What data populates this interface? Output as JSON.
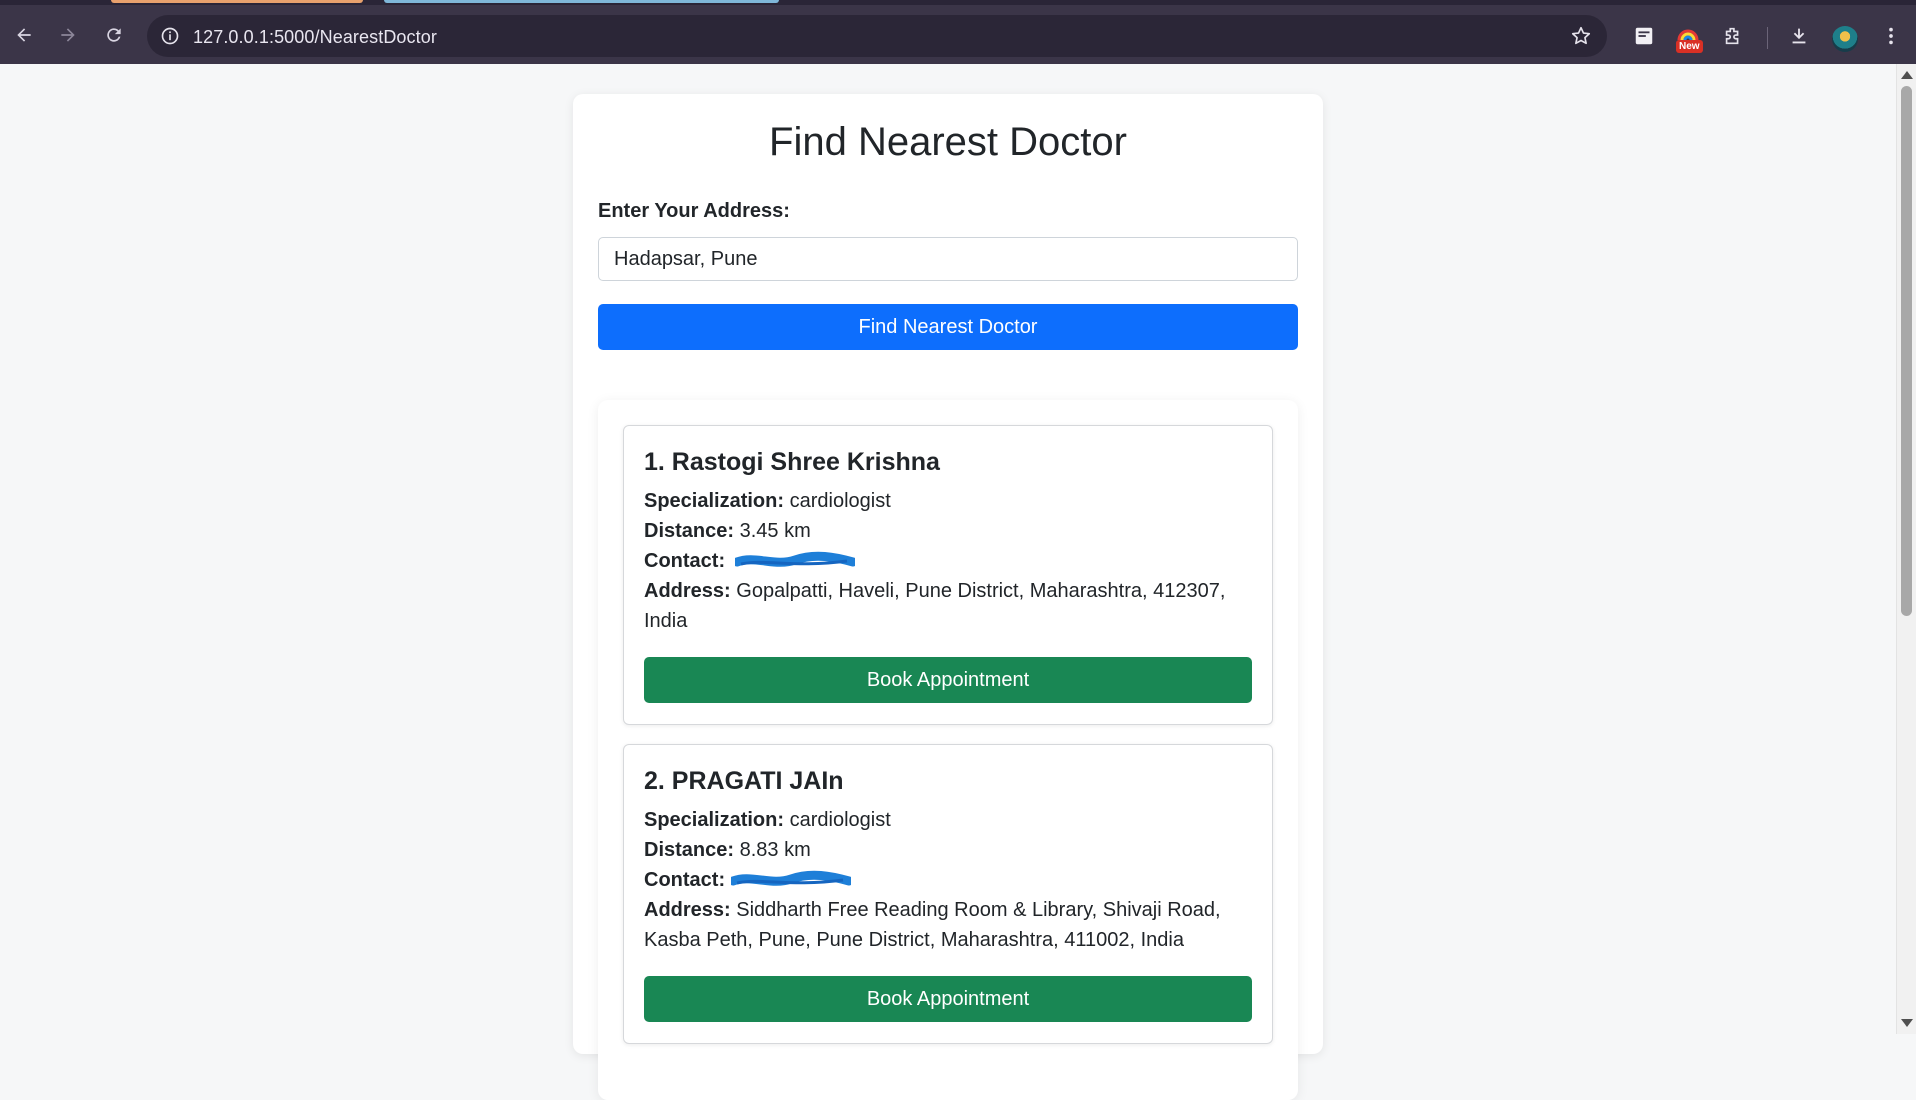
{
  "browser": {
    "url": "127.0.0.1:5000/NearestDoctor",
    "new_badge": "New"
  },
  "page": {
    "title": "Find Nearest Doctor",
    "address_label": "Enter Your Address:",
    "address_value": "Hadapsar, Pune",
    "find_button": "Find Nearest Doctor"
  },
  "labels": {
    "specialization": "Specialization:",
    "distance": "Distance:",
    "contact": "Contact:",
    "address": "Address:"
  },
  "doctors": [
    {
      "name": "1. Rastogi Shree Krishna",
      "specialization": "cardiologist",
      "distance": "3.45 km",
      "contact": "(redacted)",
      "address": "Gopalpatti, Haveli, Pune District, Maharashtra, 412307, India",
      "button": "Book Appointment"
    },
    {
      "name": "2. PRAGATI JAIn",
      "specialization": "cardiologist",
      "distance": "8.83 km",
      "contact": "(redacted)",
      "address": "Siddharth Free Reading Room & Library, Shivaji Road, Kasba Peth, Pune, Pune District, Maharashtra, 411002, India",
      "button": "Book Appointment"
    }
  ],
  "colors": {
    "primary": "#0d6efd",
    "success": "#198754",
    "chrome": "#3b3548",
    "redaction": "#1e7fd8"
  }
}
